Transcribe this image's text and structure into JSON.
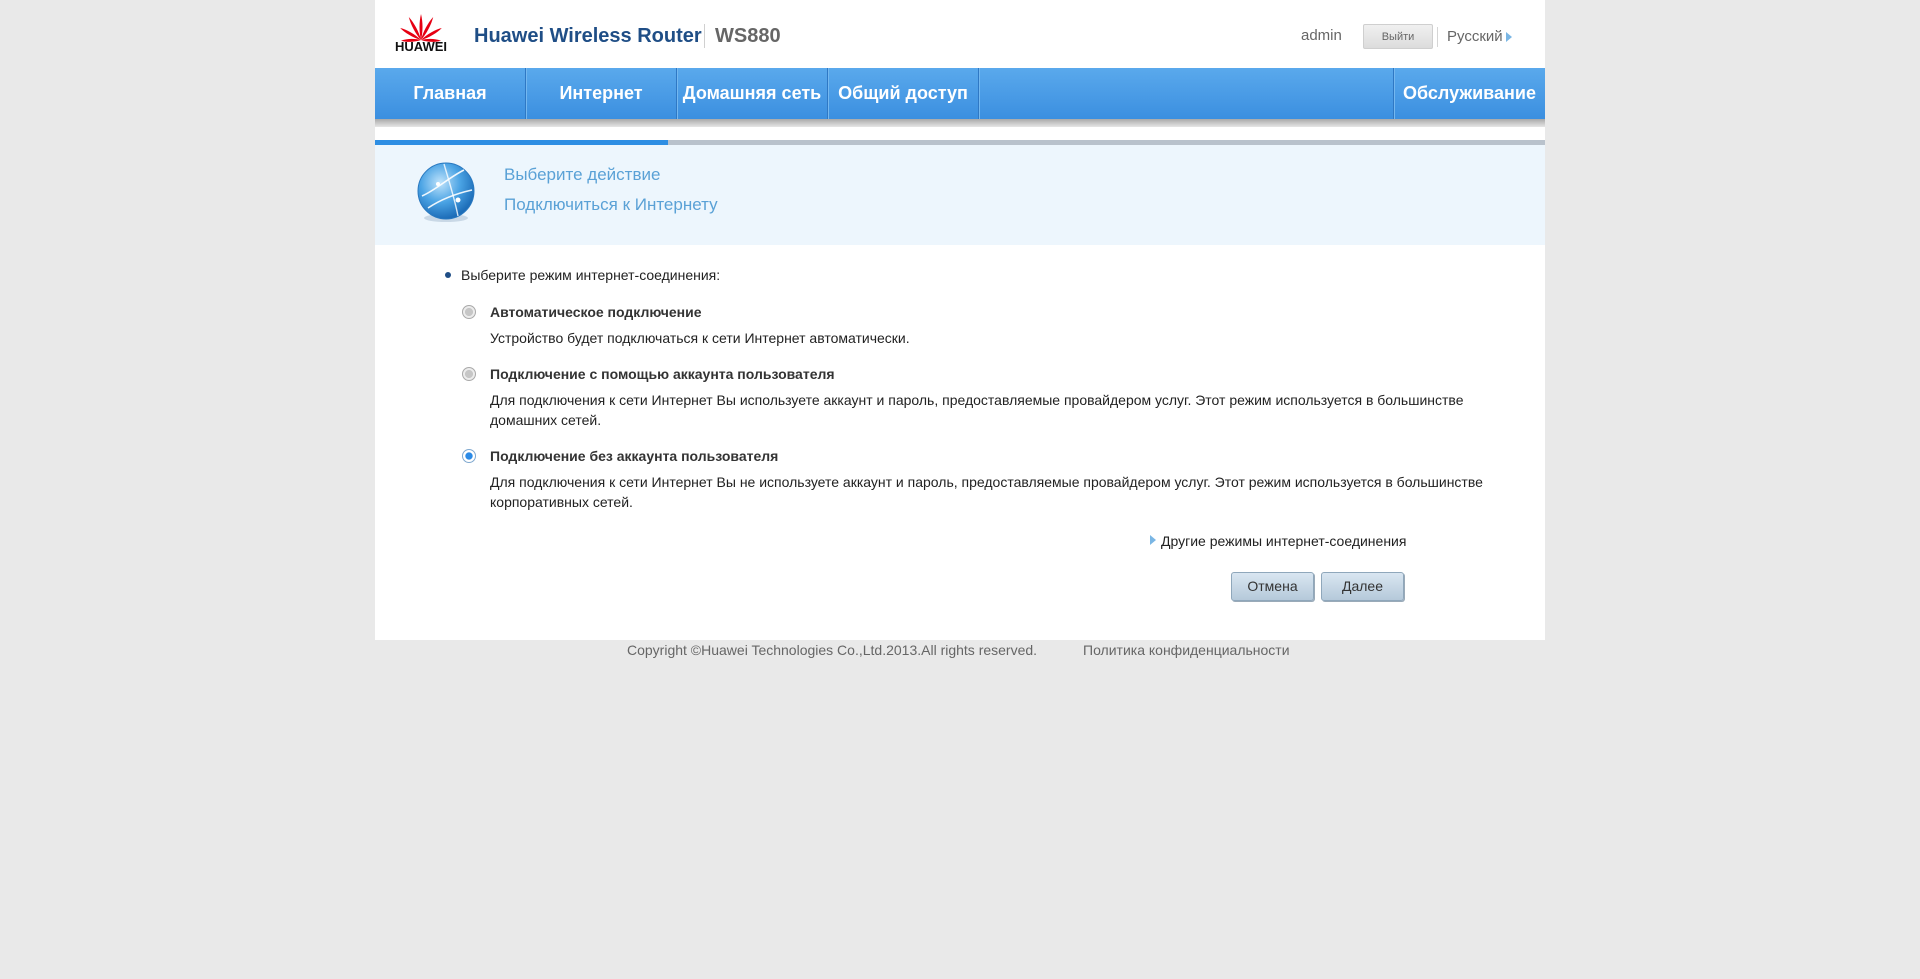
{
  "header": {
    "logo_text": "HUAWEI",
    "product": "Huawei Wireless Router",
    "model": "WS880",
    "user": "admin",
    "logout_label": "Выйти",
    "language": "Русский"
  },
  "nav": {
    "items": [
      "Главная",
      "Интернет",
      "Домашняя сеть",
      "Общий доступ"
    ],
    "right_item": "Обслуживание"
  },
  "wizard": {
    "progress": 0.25,
    "step_title": "Выберите действие",
    "step_subtitle": "Подключиться к Интернету"
  },
  "content": {
    "prompt": "Выберите режим интернет-соединения:",
    "options": [
      {
        "title": "Автоматическое подключение",
        "description": "Устройство будет подключаться к сети Интернет автоматически.",
        "selected": false
      },
      {
        "title": "Подключение с помощью аккаунта пользователя",
        "description": "Для подключения к сети Интернет Вы используете аккаунт и пароль, предоставляемые провайдером услуг. Этот режим используется в большинстве домашних сетей.",
        "selected": false
      },
      {
        "title": "Подключение без аккаунта пользователя",
        "description": "Для подключения к сети Интернет Вы не используете аккаунт и пароль, предоставляемые провайдером услуг. Этот режим используется в большинстве корпоративных сетей.",
        "selected": true
      }
    ],
    "more_modes_link": "Другие режимы интернет-соединения",
    "cancel_label": "Отмена",
    "next_label": "Далее"
  },
  "footer": {
    "copyright": "Copyright ©Huawei Technologies Co.,Ltd.2013.All rights reserved.",
    "privacy": "Политика конфиденциальности"
  },
  "colors": {
    "brand_blue": "#3b8fe0",
    "title_blue": "#1f4e86",
    "huawei_red": "#e60012"
  }
}
